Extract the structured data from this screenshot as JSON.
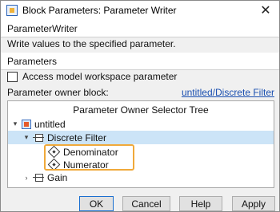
{
  "window": {
    "title": "Block Parameters: Parameter Writer",
    "close_glyph": "✕",
    "app_icon": "simulink-block-icon"
  },
  "block": {
    "name": "ParameterWriter",
    "description": "Write values to the specified parameter."
  },
  "parameters": {
    "section_label": "Parameters",
    "checkbox_label": "Access model workspace parameter",
    "checkbox_checked": false,
    "owner_label": "Parameter owner block:",
    "owner_link": "untitled/Discrete Filter"
  },
  "tree": {
    "title": "Parameter Owner Selector Tree",
    "root": {
      "label": "untitled",
      "expanded": true,
      "icon": "model-icon"
    },
    "children": [
      {
        "label": "Discrete Filter",
        "expanded": true,
        "selected": true,
        "icon": "block-icon",
        "params": [
          {
            "label": "Denominator",
            "icon": "parameter-icon"
          },
          {
            "label": "Numerator",
            "icon": "parameter-icon"
          }
        ]
      },
      {
        "label": "Gain",
        "expanded": false,
        "icon": "block-icon"
      }
    ],
    "highlight_color": "#f0a93a"
  },
  "buttons": {
    "ok": "OK",
    "cancel": "Cancel",
    "help": "Help",
    "apply": "Apply"
  }
}
